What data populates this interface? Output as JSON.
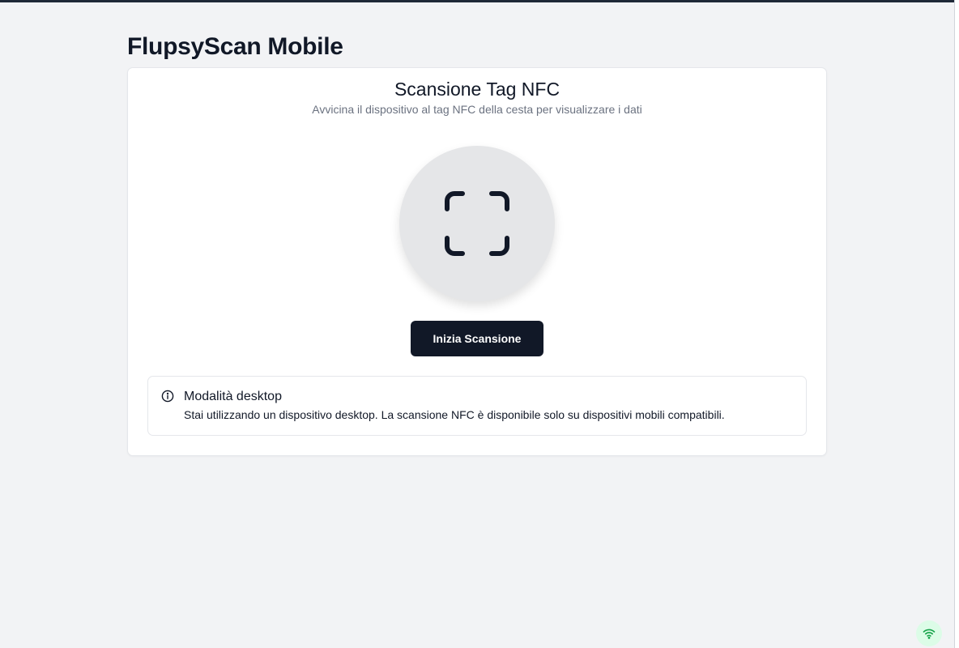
{
  "app": {
    "title": "FlupsyScan Mobile"
  },
  "scan_card": {
    "title": "Scansione Tag NFC",
    "subtitle": "Avvicina il dispositivo al tag NFC della cesta per visualizzare i dati",
    "scan_icon": "scan-frame-icon",
    "button_label": "Inizia Scansione"
  },
  "alert": {
    "icon": "info-icon",
    "title": "Modalità desktop",
    "message": "Stai utilizzando un dispositivo desktop. La scansione NFC è disponibile solo su dispositivi mobili compatibili."
  },
  "status": {
    "icon": "wifi-icon",
    "color": "#16a34a"
  },
  "colors": {
    "primary": "#111827",
    "background": "#f2f3f5",
    "muted_text": "#6b7280",
    "online": "#16a34a"
  }
}
